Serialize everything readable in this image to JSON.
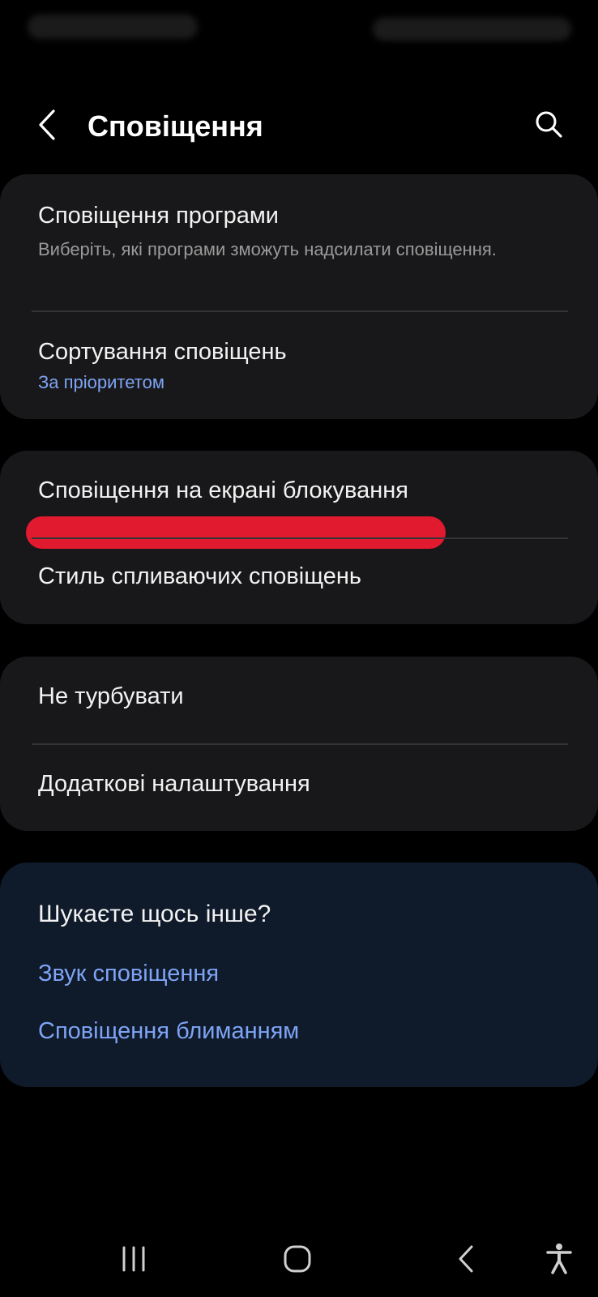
{
  "header": {
    "title": "Сповіщення",
    "back_icon": "chevron-left-icon",
    "search_icon": "search-icon"
  },
  "group1": {
    "app_notifications": {
      "title": "Сповіщення програми",
      "subtitle": "Виберіть, які програми зможуть надсилати сповіщення."
    },
    "sorting": {
      "title": "Сортування сповіщень",
      "value": "За пріоритетом"
    }
  },
  "group2": {
    "lock_screen": {
      "title": "Сповіщення на екрані блокування"
    },
    "popup_style": {
      "title": "Стиль спливаючих сповіщень"
    }
  },
  "group3": {
    "dnd": {
      "title": "Не турбувати"
    },
    "advanced": {
      "title": "Додаткові налаштування"
    }
  },
  "suggestions": {
    "title": "Шукаєте щось інше?",
    "links": [
      "Звук сповіщення",
      "Сповіщення блиманням"
    ]
  },
  "navbar": {
    "recents_icon": "recents-icon",
    "home_icon": "home-icon",
    "back_icon": "back-icon",
    "accessibility_icon": "accessibility-icon"
  },
  "colors": {
    "background": "#000000",
    "card": "#18181a",
    "suggestion_card": "#0f1a2a",
    "accent": "#7ea4f5",
    "redaction": "#e21a2f"
  }
}
